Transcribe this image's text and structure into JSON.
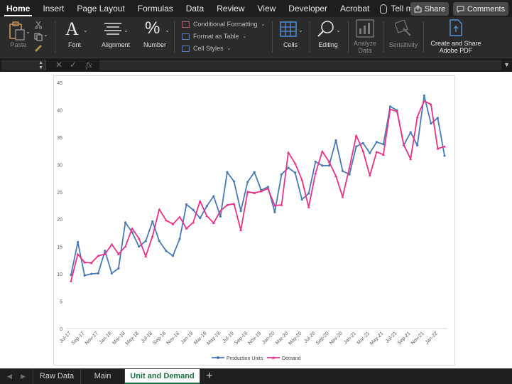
{
  "ribbon_tabs": [
    "Home",
    "Insert",
    "Page Layout",
    "Formulas",
    "Data",
    "Review",
    "View",
    "Developer",
    "Acrobat"
  ],
  "tell_me": "Tell me",
  "share_label": "Share",
  "comments_label": "Comments",
  "ribbon": {
    "paste": "Paste",
    "font": "Font",
    "alignment": "Alignment",
    "number": "Number",
    "conditional_formatting": "Conditional Formatting",
    "format_as_table": "Format as Table",
    "cell_styles": "Cell Styles",
    "cells": "Cells",
    "editing": "Editing",
    "analyze_data_1": "Analyze",
    "analyze_data_2": "Data",
    "sensitivity": "Sensitivity",
    "adobe_1": "Create and Share",
    "adobe_2": "Adobe PDF"
  },
  "formula_bar": {
    "fx": "fx",
    "cancel": "✕",
    "enter": "✓"
  },
  "sheet_tabs": [
    "Raw Data",
    "Main",
    "Unit and Demand"
  ],
  "active_sheet": "Unit and Demand",
  "colors": {
    "production": "#4a7ab5",
    "demand": "#e8328a",
    "active_tab_text": "#1e7145"
  },
  "chart_data": {
    "type": "line",
    "x": [
      "Jul-17",
      "Aug-17",
      "Sep-17",
      "Oct-17",
      "Nov-17",
      "Dec-17",
      "Jan-18",
      "Feb-18",
      "Mar-18",
      "Apr-18",
      "May-18",
      "Jun-18",
      "Jul-18",
      "Aug-18",
      "Sep-18",
      "Oct-18",
      "Nov-18",
      "Dec-18",
      "Jan-19",
      "Feb-19",
      "Mar-19",
      "Apr-19",
      "May-19",
      "Jun-19",
      "Jul-19",
      "Aug-19",
      "Sep-19",
      "Oct-19",
      "Nov-19",
      "Dec-19",
      "Jan-20",
      "Feb-20",
      "Mar-20",
      "Apr-20",
      "May-20",
      "Jun-20",
      "Jul-20",
      "Aug-20",
      "Sep-20",
      "Oct-20",
      "Nov-20",
      "Dec-20",
      "Jan-21",
      "Feb-21",
      "Mar-21",
      "Apr-21",
      "May-21",
      "Jun-21",
      "Jul-21",
      "Aug-21",
      "Sep-21",
      "Oct-21",
      "Nov-21",
      "Dec-21",
      "Jan-22",
      "Feb-22"
    ],
    "tick_labels": [
      "Jul-17",
      "Sep-17",
      "Nov-17",
      "Jan-18",
      "Mar-18",
      "May-18",
      "Jul-18",
      "Sep-18",
      "Nov-18",
      "Jan-19",
      "Mar-19",
      "May-19",
      "Jul-19",
      "Sep-19",
      "Nov-19",
      "Jan-20",
      "Mar-20",
      "May-20",
      "Jul-20",
      "Sep-20",
      "Nov-20",
      "Jan-21",
      "Mar-21",
      "May-21",
      "Jul-21",
      "Sep-21",
      "Nov-21",
      "Jan-22"
    ],
    "series": [
      {
        "name": "Production Units",
        "values": [
          9.8,
          15.8,
          9.7,
          10.0,
          10.1,
          14.2,
          10.1,
          11.0,
          19.4,
          17.6,
          15.0,
          16.0,
          19.6,
          16.0,
          14.2,
          13.3,
          16.4,
          22.7,
          21.7,
          20.2,
          22.4,
          24.2,
          20.5,
          28.6,
          26.9,
          21.5,
          26.8,
          28.6,
          25.3,
          25.9,
          21.3,
          28.2,
          29.4,
          28.5,
          23.6,
          24.7,
          30.5,
          29.8,
          29.8,
          34.4,
          28.8,
          28.2,
          33.3,
          33.9,
          32.1,
          34.1,
          33.7,
          40.6,
          39.9,
          33.5,
          35.9,
          33.5,
          42.6,
          37.5,
          38.5,
          31.6
        ]
      },
      {
        "name": "Demand",
        "values": [
          8.7,
          13.6,
          12.1,
          12.0,
          13.3,
          13.6,
          15.4,
          13.6,
          15.0,
          18.3,
          16.5,
          13.2,
          16.9,
          21.8,
          19.8,
          19.1,
          20.4,
          18.3,
          19.4,
          23.3,
          20.6,
          19.3,
          21.5,
          22.6,
          22.8,
          18.0,
          25.0,
          24.8,
          25.1,
          25.6,
          22.5,
          22.6,
          32.2,
          30.2,
          27.2,
          22.2,
          28.4,
          32.4,
          30.5,
          27.9,
          24.1,
          29.4,
          35.3,
          32.5,
          28.0,
          32.3,
          31.8,
          40.1,
          39.7,
          33.6,
          31.0,
          38.7,
          41.6,
          41.0,
          32.9,
          33.3
        ]
      }
    ],
    "ylim": [
      0,
      45
    ],
    "yticks": [
      0,
      5,
      10,
      15,
      20,
      25,
      30,
      35,
      40,
      45
    ],
    "grid": false,
    "legend": "bottom",
    "title": "",
    "xlabel": "",
    "ylabel": ""
  }
}
